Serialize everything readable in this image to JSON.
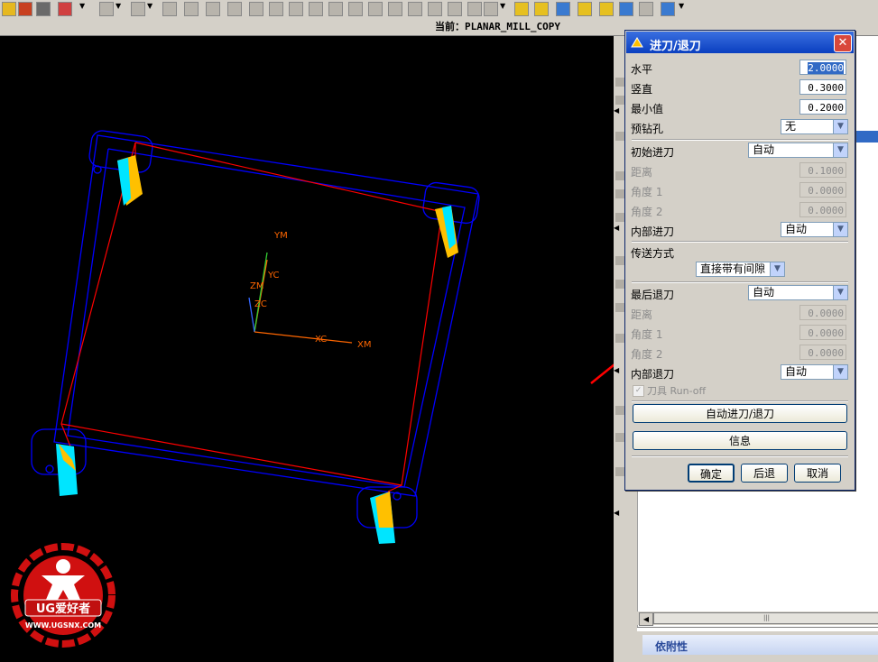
{
  "status": {
    "current_label": "当前：PLANAR_MILL_COPY"
  },
  "dialog": {
    "title": "进刀/退刀",
    "rows": {
      "horizontal": {
        "label": "水平",
        "value": "2.0000"
      },
      "vertical": {
        "label": "竖直",
        "value": "0.3000"
      },
      "minimum": {
        "label": "最小值",
        "value": "0.2000"
      },
      "predrill": {
        "label": "预钻孔",
        "value": "无"
      },
      "initial_engage": {
        "label": "初始进刀",
        "value": "自动"
      },
      "engage_distance": {
        "label": "距离",
        "value": "0.1000"
      },
      "engage_angle1": {
        "label": "角度 1",
        "value": "0.0000"
      },
      "engage_angle2": {
        "label": "角度 2",
        "value": "0.0000"
      },
      "internal_engage": {
        "label": "内部进刀",
        "value": "自动"
      },
      "transfer_label": "传送方式",
      "transfer_method": "直接带有间隙",
      "final_retract": {
        "label": "最后退刀",
        "value": "自动"
      },
      "retract_distance": {
        "label": "距离",
        "value": "0.0000"
      },
      "retract_angle1": {
        "label": "角度 1",
        "value": "0.0000"
      },
      "retract_angle2": {
        "label": "角度 2",
        "value": "0.0000"
      },
      "internal_retract": {
        "label": "内部退刀",
        "value": "自动"
      },
      "tool_runoff": {
        "label": "刀具 Run-off",
        "checked": true
      }
    },
    "buttons": {
      "auto_engage_retract": "自动进刀/退刀",
      "info": "信息",
      "ok": "确定",
      "back": "后退",
      "cancel": "取消"
    }
  },
  "viewport_labels": {
    "ym": "YM",
    "yc": "YC",
    "zm": "ZM",
    "zc": "ZC",
    "xc": "XC",
    "xm": "XM"
  },
  "watermark": {
    "brand": "UG爱好者",
    "url": "WWW.UGSNX.COM"
  },
  "right_panel": {
    "section_title": "依附性"
  },
  "colors": {
    "path_blue": "#0000ff",
    "path_red": "#ff0000",
    "tool_yellow": "#ffc000",
    "tool_cyan": "#00e5ff",
    "axis_orange": "#ff6600",
    "arrow_red": "#ff0000"
  }
}
